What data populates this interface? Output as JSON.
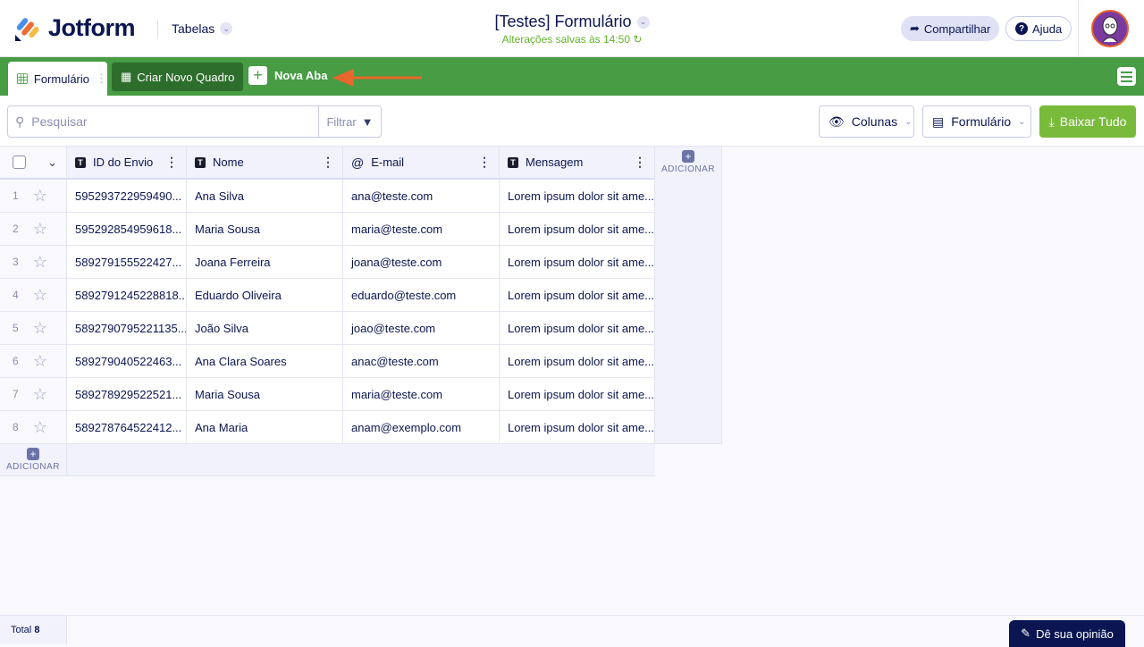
{
  "header": {
    "brand": "Jotform",
    "product": "Tabelas",
    "title": "[Testes] Formulário",
    "saved_status": "Alterações salvas às 14:50",
    "share": "Compartilhar",
    "help": "Ajuda"
  },
  "tabs": {
    "active": "Formulário",
    "create_board": "Criar Novo Quadro",
    "new_tab": "Nova Aba"
  },
  "toolbar": {
    "search_placeholder": "Pesquisar",
    "filter": "Filtrar",
    "columns": "Colunas",
    "form": "Formulário",
    "download": "Baixar Tudo"
  },
  "table": {
    "columns": [
      {
        "label": "ID do Envio",
        "type": "T"
      },
      {
        "label": "Nome",
        "type": "T"
      },
      {
        "label": "E-mail",
        "type": "@"
      },
      {
        "label": "Mensagem",
        "type": "T"
      }
    ],
    "rows": [
      {
        "n": "1",
        "id": "595293722959490...",
        "name": "Ana Silva",
        "email": "ana@teste.com",
        "msg": "Lorem ipsum dolor sit ame..."
      },
      {
        "n": "2",
        "id": "595292854959618...",
        "name": "Maria Sousa",
        "email": "maria@teste.com",
        "msg": "Lorem ipsum dolor sit ame..."
      },
      {
        "n": "3",
        "id": "589279155522427...",
        "name": "Joana Ferreira",
        "email": "joana@teste.com",
        "msg": "Lorem ipsum dolor sit ame..."
      },
      {
        "n": "4",
        "id": "5892791245228818...",
        "name": "Eduardo Oliveira",
        "email": "eduardo@teste.com",
        "msg": "Lorem ipsum dolor sit ame..."
      },
      {
        "n": "5",
        "id": "589279079522113​5...",
        "name": "João Silva",
        "email": "joao@teste.com",
        "msg": "Lorem ipsum dolor sit ame..."
      },
      {
        "n": "6",
        "id": "589279040522463...",
        "name": "Ana Clara Soares",
        "email": "anac@teste.com",
        "msg": "Lorem ipsum dolor sit ame..."
      },
      {
        "n": "7",
        "id": "589278929522521...",
        "name": "Maria Sousa",
        "email": "maria@teste.com",
        "msg": "Lorem ipsum dolor sit ame..."
      },
      {
        "n": "8",
        "id": "589278764522412...",
        "name": "Ana Maria",
        "email": "anam@exemplo.com",
        "msg": "Lorem ipsum dolor sit ame..."
      }
    ],
    "add_column": "ADICIONAR",
    "add_row": "ADICIONAR"
  },
  "footer": {
    "total_label": "Total",
    "total": "8",
    "feedback": "Dê sua opinião"
  },
  "colors": {
    "green": "#479c44",
    "download": "#78bb3b",
    "navy": "#0a1551",
    "arrow": "#e8672c"
  }
}
